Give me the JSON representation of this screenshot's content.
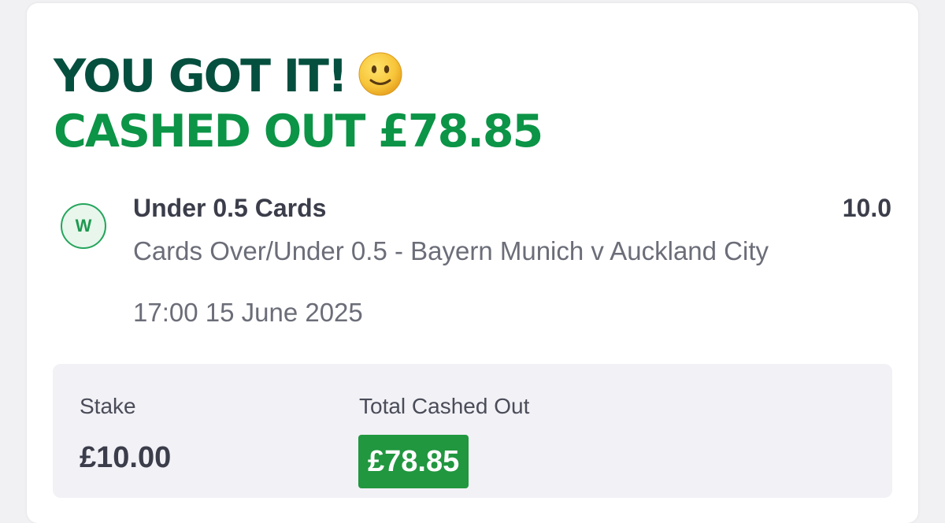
{
  "headline": {
    "line1": "YOU GOT IT!",
    "emoji_icon": "slightly-smiling-face-icon",
    "line2": "CASHED OUT £78.85"
  },
  "selection": {
    "result_badge": "W",
    "name": "Under 0.5 Cards",
    "odds": "10.0",
    "market": "Cards Over/Under 0.5 - Bayern Munich v Auckland City",
    "datetime": "17:00 15 June 2025"
  },
  "summary": {
    "stake_label": "Stake",
    "stake_value": "£10.00",
    "total_label": "Total Cashed Out",
    "total_value": "£78.85"
  },
  "colors": {
    "headline_dark": "#054f3f",
    "headline_green": "#0c9447",
    "cashout_badge": "#21973f",
    "win_badge": "#25a55c"
  }
}
